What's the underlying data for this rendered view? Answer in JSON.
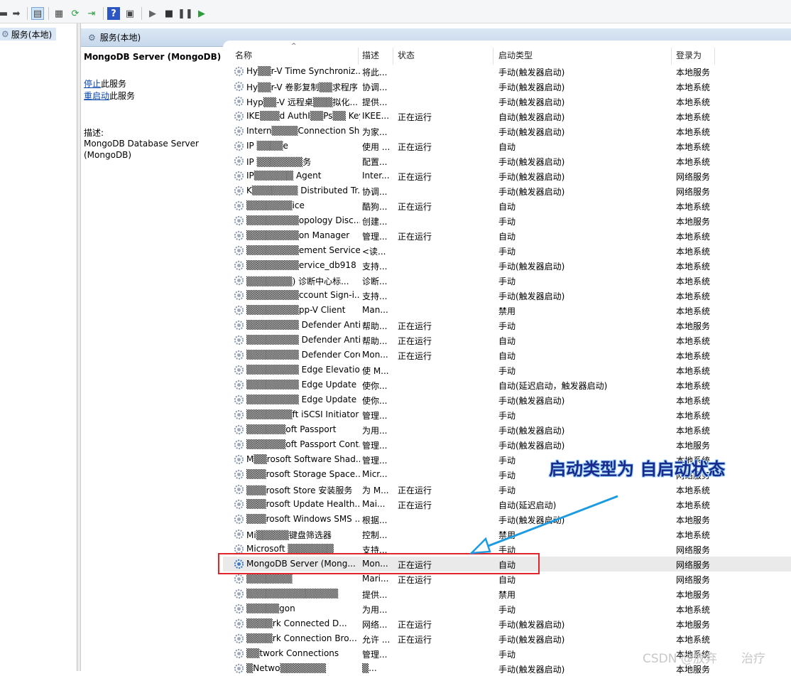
{
  "tree": {
    "root_label": "服务(本地)"
  },
  "header": {
    "title": "服务(本地)"
  },
  "detail": {
    "service_title": "MongoDB Server (MongoDB)",
    "stop_link": "停止",
    "stop_suffix": "此服务",
    "restart_link": "重启动",
    "restart_suffix": "此服务",
    "description_label": "描述:",
    "description": "MongoDB Database Server (MongoDB)"
  },
  "columns": {
    "name": "名称",
    "description": "描述",
    "status": "状态",
    "startup": "启动类型",
    "logon": "登录为"
  },
  "rows": [
    {
      "name": "Hy▒▒r-V Time Synchroniz...",
      "desc": "将此...",
      "status": "",
      "startup": "手动(触发器启动)",
      "logon": "本地服务"
    },
    {
      "name": "Hy▒▒r-V 卷影复制▒▒求程序",
      "desc": "协调...",
      "status": "",
      "startup": "手动(触发器启动)",
      "logon": "本地系统"
    },
    {
      "name": "Hyp▒▒-V 远程桌▒▒▒拟化...",
      "desc": "提供...",
      "status": "",
      "startup": "手动(触发器启动)",
      "logon": "本地系统"
    },
    {
      "name": "IKE▒▒▒d AuthI▒▒Ps▒▒ Key...",
      "desc": "IKEE...",
      "status": "正在运行",
      "startup": "自动(触发器启动)",
      "logon": "本地系统"
    },
    {
      "name": "Intern▒▒▒▒Connection Shari...",
      "desc": "为家...",
      "status": "",
      "startup": "手动(触发器启动)",
      "logon": "本地系统"
    },
    {
      "name": "IP ▒▒▒▒e",
      "desc": "使用 ...",
      "status": "正在运行",
      "startup": "自动",
      "logon": "本地系统"
    },
    {
      "name": "IP ▒▒▒▒▒▒▒务",
      "desc": "配置...",
      "status": "",
      "startup": "手动(触发器启动)",
      "logon": "本地系统"
    },
    {
      "name": "IP▒▒▒▒▒▒ Agent",
      "desc": "Inter...",
      "status": "正在运行",
      "startup": "手动(触发器启动)",
      "logon": "网络服务"
    },
    {
      "name": "K▒▒▒▒▒▒▒ Distributed Tr...",
      "desc": "协调...",
      "status": "",
      "startup": "手动(触发器启动)",
      "logon": "网络服务"
    },
    {
      "name": "▒▒▒▒▒▒▒ice",
      "desc": "酷狗...",
      "status": "正在运行",
      "startup": "自动",
      "logon": "本地系统"
    },
    {
      "name": "▒▒▒▒▒▒▒▒opology Disc...",
      "desc": "创建...",
      "status": "",
      "startup": "手动",
      "logon": "本地服务"
    },
    {
      "name": "▒▒▒▒▒▒▒▒on Manager",
      "desc": "管理...",
      "status": "正在运行",
      "startup": "自动",
      "logon": "本地系统"
    },
    {
      "name": "▒▒▒▒▒▒▒▒ement Service",
      "desc": "<读...",
      "status": "",
      "startup": "手动",
      "logon": "本地系统"
    },
    {
      "name": "▒▒▒▒▒▒▒▒ervice_db918",
      "desc": "支持...",
      "status": "",
      "startup": "手动(触发器启动)",
      "logon": "本地系统"
    },
    {
      "name": "▒▒▒▒▒▒▒) 诊断中心标...",
      "desc": "诊断...",
      "status": "",
      "startup": "手动",
      "logon": "本地系统"
    },
    {
      "name": "▒▒▒▒▒▒▒▒ccount Sign-i...",
      "desc": "支持...",
      "status": "",
      "startup": "手动(触发器启动)",
      "logon": "本地系统"
    },
    {
      "name": "▒▒▒▒▒▒▒▒pp-V Client",
      "desc": "Man...",
      "status": "",
      "startup": "禁用",
      "logon": "本地系统"
    },
    {
      "name": "▒▒▒▒▒▒▒▒ Defender Antiv...",
      "desc": "帮助...",
      "status": "正在运行",
      "startup": "手动",
      "logon": "本地服务"
    },
    {
      "name": "▒▒▒▒▒▒▒▒ Defender Antiv...",
      "desc": "帮助...",
      "status": "正在运行",
      "startup": "自动",
      "logon": "本地系统"
    },
    {
      "name": "▒▒▒▒▒▒▒▒ Defender Core...",
      "desc": "Mon...",
      "status": "正在运行",
      "startup": "自动",
      "logon": "本地系统"
    },
    {
      "name": "▒▒▒▒▒▒▒▒ Edge Elevation...",
      "desc": "使 M...",
      "status": "",
      "startup": "手动",
      "logon": "本地系统"
    },
    {
      "name": "▒▒▒▒▒▒▒▒ Edge Update ...",
      "desc": "使你...",
      "status": "",
      "startup": "自动(延迟启动，触发器启动)",
      "logon": "本地系统"
    },
    {
      "name": "▒▒▒▒▒▒▒▒ Edge Update ...",
      "desc": "使你...",
      "status": "",
      "startup": "手动(触发器启动)",
      "logon": "本地系统"
    },
    {
      "name": "▒▒▒▒▒▒▒ft iSCSI Initiator ...",
      "desc": "管理...",
      "status": "",
      "startup": "手动",
      "logon": "本地系统"
    },
    {
      "name": "▒▒▒▒▒▒oft Passport",
      "desc": "为用...",
      "status": "",
      "startup": "手动(触发器启动)",
      "logon": "本地系统"
    },
    {
      "name": "▒▒▒▒▒▒oft Passport Cont...",
      "desc": "管理...",
      "status": "",
      "startup": "手动(触发器启动)",
      "logon": "本地服务"
    },
    {
      "name": "M▒▒rosoft Software Shad...",
      "desc": "管理...",
      "status": "",
      "startup": "手动",
      "logon": "本地系统"
    },
    {
      "name": "▒▒▒rosoft Storage Space...",
      "desc": "Micr...",
      "status": "",
      "startup": "手动",
      "logon": "网络服务"
    },
    {
      "name": "▒▒▒rosoft Store 安装服务",
      "desc": "为 M...",
      "status": "正在运行",
      "startup": "手动",
      "logon": "本地系统"
    },
    {
      "name": "▒▒▒rosoft Update Health...",
      "desc": "Mai...",
      "status": "正在运行",
      "startup": "自动(延迟启动)",
      "logon": "本地系统"
    },
    {
      "name": "▒▒▒rosoft Windows SMS ...",
      "desc": "根据...",
      "status": "",
      "startup": "手动(触发器启动)",
      "logon": "本地服务"
    },
    {
      "name": "Mi▒▒▒▒▒键盘筛选器",
      "desc": "控制...",
      "status": "",
      "startup": "禁用",
      "logon": "本地系统"
    },
    {
      "name": "Microsoft ▒▒▒▒▒▒▒",
      "desc": "支持...",
      "status": "",
      "startup": "手动",
      "logon": "网络服务"
    },
    {
      "name": "MongoDB Server (Mong...",
      "desc": "Mon...",
      "status": "正在运行",
      "startup": "自动",
      "logon": "网络服务",
      "selected": true
    },
    {
      "name": "▒▒▒▒▒▒▒",
      "desc": "Mari...",
      "status": "正在运行",
      "startup": "自动",
      "logon": "网络服务"
    },
    {
      "name": "▒▒▒▒▒▒▒▒▒▒▒▒▒▒",
      "desc": "提供...",
      "status": "",
      "startup": "禁用",
      "logon": "本地服务"
    },
    {
      "name": "▒▒▒▒▒gon",
      "desc": "为用...",
      "status": "",
      "startup": "手动",
      "logon": "本地系统"
    },
    {
      "name": "▒▒▒▒rk Connected D...",
      "desc": "网络...",
      "status": "正在运行",
      "startup": "手动(触发器启动)",
      "logon": "本地服务"
    },
    {
      "name": "▒▒▒▒rk Connection Bro...",
      "desc": "允许 ...",
      "status": "正在运行",
      "startup": "手动(触发器启动)",
      "logon": "本地系统"
    },
    {
      "name": "▒▒twork Connections",
      "desc": "管理...",
      "status": "",
      "startup": "手动",
      "logon": "本地系统"
    },
    {
      "name": "▒Netwo▒▒▒▒▒▒▒",
      "desc": "▒...",
      "status": "",
      "startup": "手动(触发器启动)",
      "logon": "本地服务"
    }
  ],
  "annotation": {
    "text": "启动类型为 自启动状态"
  },
  "watermark": "CSDN @放弃　　治疗",
  "colors": {
    "highlight_box": "#e0262b",
    "annotation_text": "#1a2a8a",
    "arrow": "#1e9be0"
  }
}
